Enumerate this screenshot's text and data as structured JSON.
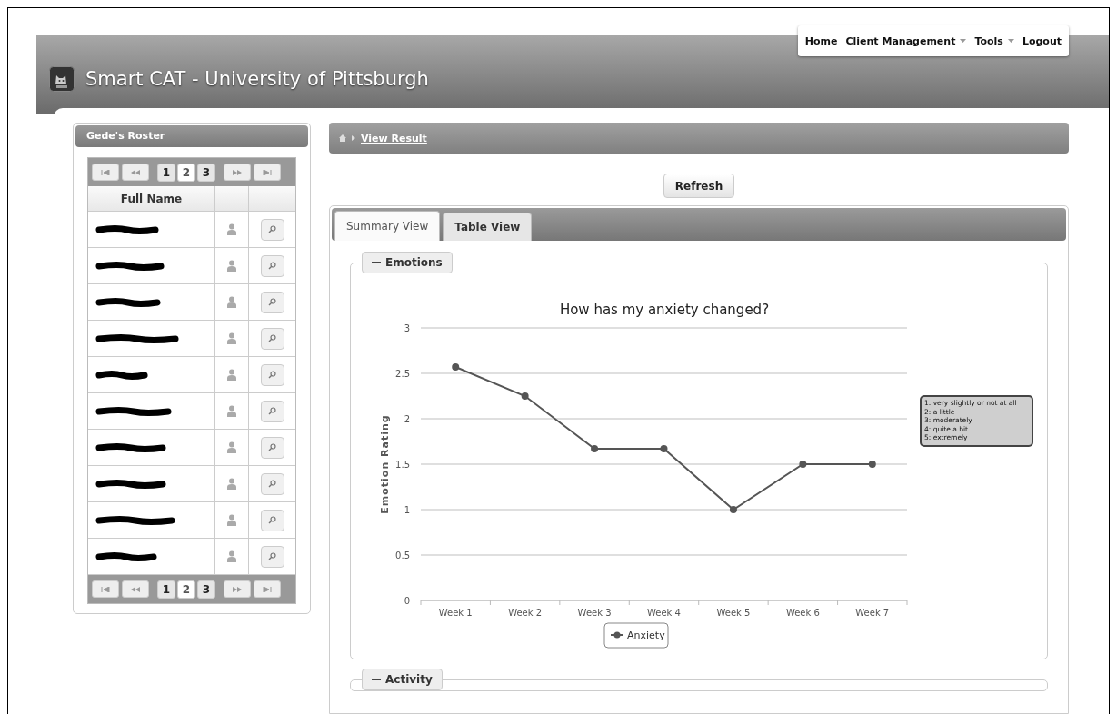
{
  "header": {
    "title": "Smart CAT - University of Pittsburgh",
    "nav": [
      {
        "label": "Home",
        "dropdown": false
      },
      {
        "label": "Client Management",
        "dropdown": true
      },
      {
        "label": "Tools",
        "dropdown": true
      },
      {
        "label": "Logout",
        "dropdown": false
      }
    ]
  },
  "roster": {
    "title": "Gede's Roster",
    "top_pager": {
      "pages": [
        {
          "label": "1",
          "selected": false
        },
        {
          "label": "2",
          "selected": true
        },
        {
          "label": "3",
          "selected": false
        }
      ]
    },
    "columns": [
      "Full Name"
    ],
    "rows": [
      {
        "name_redacted": true
      },
      {
        "name_redacted": true
      },
      {
        "name_redacted": true
      },
      {
        "name_redacted": true
      },
      {
        "name_redacted": true
      },
      {
        "name_redacted": true
      },
      {
        "name_redacted": true
      },
      {
        "name_redacted": true
      },
      {
        "name_redacted": true
      },
      {
        "name_redacted": true
      }
    ],
    "bottom_pager": {
      "pages": [
        {
          "label": "1",
          "selected": false
        },
        {
          "label": "2",
          "selected": true
        },
        {
          "label": "3",
          "selected": false
        }
      ]
    }
  },
  "breadcrumb": {
    "link": "View Result"
  },
  "refresh_button": "Refresh",
  "tabs": [
    {
      "label": "Summary View",
      "selected": true
    },
    {
      "label": "Table View",
      "selected": false
    }
  ],
  "sections": [
    {
      "title": "Emotions",
      "expanded": true,
      "chart_data": {
        "type": "line",
        "title": "How has my anxiety changed?",
        "ylabel": "Emotion Rating",
        "categories": [
          "Week 1",
          "Week 2",
          "Week 3",
          "Week 4",
          "Week 5",
          "Week 6",
          "Week 7"
        ],
        "ylim": [
          0,
          3
        ],
        "yticks": [
          0,
          0.5,
          1,
          1.5,
          2,
          2.5,
          3
        ],
        "grid": true,
        "series": [
          {
            "name": "Anxiety",
            "color": "#555555",
            "marker": "circle",
            "values": [
              2.57,
              2.25,
              1.67,
              1.67,
              1,
              1.5,
              1.5
            ]
          }
        ],
        "annotations": [
          "1: very slightly or not at all",
          "2: a little",
          "3: moderately",
          "4: quite a bit",
          "5: extremely"
        ]
      }
    },
    {
      "title": "Activity",
      "expanded": true
    }
  ]
}
